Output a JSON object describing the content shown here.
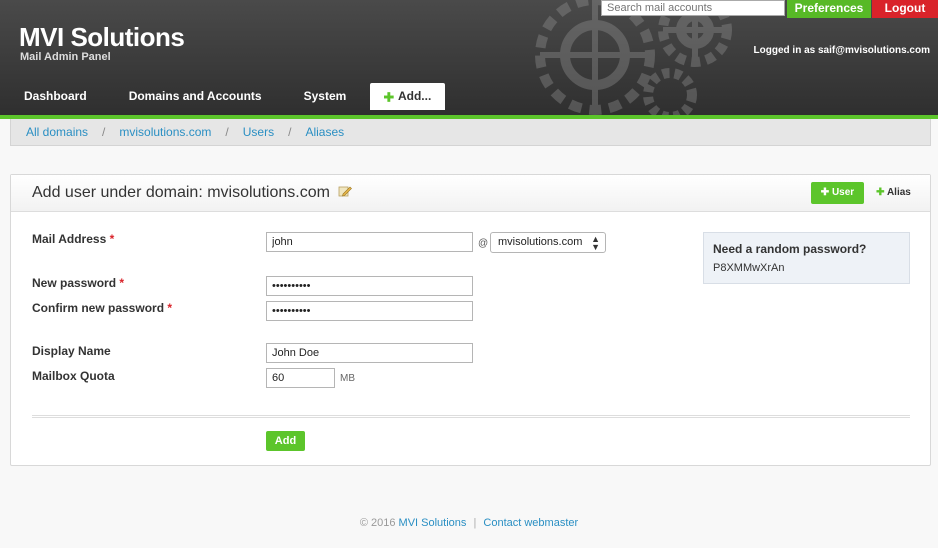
{
  "header": {
    "brand": "MVI Solutions",
    "subtitle": "Mail Admin Panel",
    "search_placeholder": "Search mail accounts",
    "preferences_label": "Preferences",
    "logout_label": "Logout",
    "logged_in_text": "Logged in as saif@mvisolutions.com"
  },
  "nav": {
    "items": [
      "Dashboard",
      "Domains and Accounts",
      "System"
    ],
    "add_label": "Add..."
  },
  "breadcrumb": [
    "All domains",
    "mvisolutions.com",
    "Users",
    "Aliases"
  ],
  "panel": {
    "title": "Add user under domain: mvisolutions.com",
    "tab_user": "User",
    "tab_alias": "Alias"
  },
  "form": {
    "mail_address_label": "Mail Address",
    "mail_address_value": "john",
    "at_sign": "@",
    "domain_selected": "mvisolutions.com",
    "new_password_label": "New password",
    "new_password_value": "••••••••••",
    "confirm_password_label": "Confirm new password",
    "confirm_password_value": "••••••••••",
    "display_name_label": "Display Name",
    "display_name_value": "John Doe",
    "quota_label": "Mailbox Quota",
    "quota_value": "60",
    "quota_unit": "MB",
    "required_mark": "*",
    "submit_label": "Add"
  },
  "random_password": {
    "title": "Need a random password?",
    "value": "P8XMMwXrAn"
  },
  "footer": {
    "copyright": "© 2016",
    "company": "MVI Solutions",
    "separator": "|",
    "contact": "Contact webmaster"
  },
  "colors": {
    "accent_green": "#5cc52b",
    "logout_red": "#d9232a",
    "link_blue": "#2a8fc3",
    "header_dark": "#3a3a3a"
  }
}
